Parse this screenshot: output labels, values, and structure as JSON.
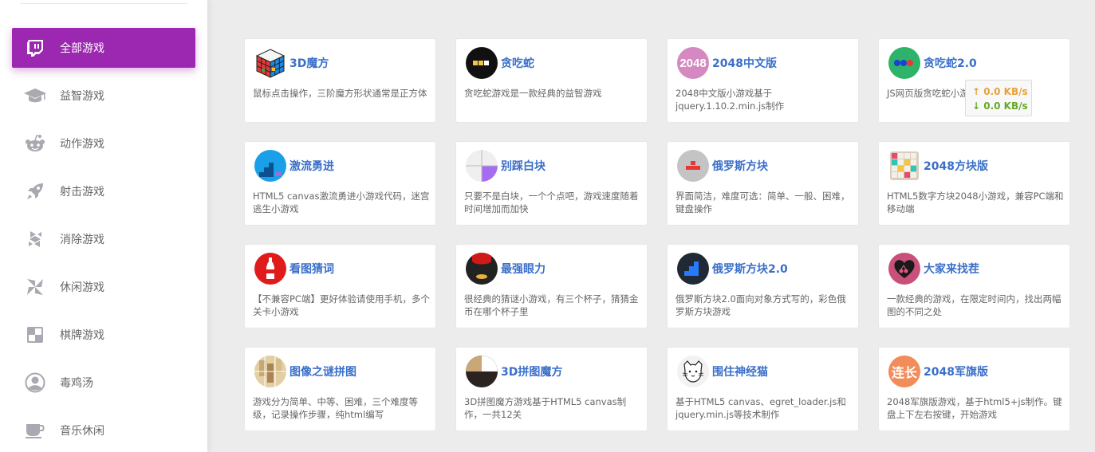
{
  "sidebar": {
    "items": [
      {
        "label": "全部游戏",
        "icon": "twitch-icon",
        "active": true
      },
      {
        "label": "益智游戏",
        "icon": "graduation-cap-icon",
        "active": false
      },
      {
        "label": "动作游戏",
        "icon": "reddit-icon",
        "active": false
      },
      {
        "label": "射击游戏",
        "icon": "rocket-icon",
        "active": false
      },
      {
        "label": "消除游戏",
        "icon": "hubspot-icon",
        "active": false
      },
      {
        "label": "休闲游戏",
        "icon": "pinwheel-icon",
        "active": false
      },
      {
        "label": "棋牌游戏",
        "icon": "chessboard-icon",
        "active": false
      },
      {
        "label": "毒鸡汤",
        "icon": "user-circle-icon",
        "active": false
      },
      {
        "label": "音乐休闲",
        "icon": "coffee-cup-icon",
        "active": false
      }
    ]
  },
  "games": [
    {
      "title": "3D魔方",
      "desc": "鼠标点击操作，三阶魔方形状通常是正方体",
      "icon": "rubiks-cube-icon"
    },
    {
      "title": "贪吃蛇",
      "desc": "贪吃蛇游戏是一款经典的益智游戏",
      "icon": "snake-icon"
    },
    {
      "title": "2048中文版",
      "desc": "2048中文版小游戏基于jquery.1.10.2.min.js制作",
      "icon": "2048-icon",
      "logo_text": "2048"
    },
    {
      "title": "贪吃蛇2.0",
      "desc": "JS网页版贪吃蛇小游戏",
      "icon": "snake-dots-icon"
    },
    {
      "title": "激流勇进",
      "desc": "HTML5 canvas激流勇进小游戏代码，迷宫逃生小游戏",
      "icon": "stairs-icon"
    },
    {
      "title": "别踩白块",
      "desc": "只要不是白块，一个个点吧，游戏速度随着时间增加而加快",
      "icon": "tiles-icon"
    },
    {
      "title": "俄罗斯方块",
      "desc": "界面简洁，难度可选：简单、一般、困难，键盘操作",
      "icon": "tetris-red-icon"
    },
    {
      "title": "2048方块版",
      "desc": "HTML5数字方块2048小游戏，兼容PC端和移动端",
      "icon": "grid-blocks-icon"
    },
    {
      "title": "看图猜词",
      "desc": "【不兼容PC端】更好体验请使用手机，多个关卡小游戏",
      "icon": "bottle-icon"
    },
    {
      "title": "最强眼力",
      "desc": "很经典的猜谜小游戏，有三个杯子，猜猜金币在哪个杯子里",
      "icon": "cup-coin-icon"
    },
    {
      "title": "俄罗斯方块2.0",
      "desc": "俄罗斯方块2.0面向对象方式写的，彩色俄罗斯方块游戏",
      "icon": "tetris-blue-icon"
    },
    {
      "title": "大家来找茬",
      "desc": "一款经典的游戏，在限定时间内，找出两幅图的不同之处",
      "icon": "heart-cherry-icon"
    },
    {
      "title": "图像之谜拼图",
      "desc": "游戏分为简单、中等、困难，三个难度等级，记录操作步骤，纯html编写",
      "icon": "puzzle-photo-icon"
    },
    {
      "title": "3D拼图魔方",
      "desc": "3D拼图魔方游戏基于HTML5 canvas制作，一共12关",
      "icon": "puzzle-cube-icon"
    },
    {
      "title": "围住神经猫",
      "desc": "基于HTML5 canvas、egret_loader.js和jquery.min.js等技术制作",
      "icon": "cat-icon"
    },
    {
      "title": "2048军旗版",
      "desc": "2048军旗版游戏，基于html5+js制作。键盘上下左右按键，开始游戏",
      "icon": "lianzhang-icon",
      "logo_text": "连长"
    }
  ],
  "netspeed": {
    "up": "↑ 0.0 KB/s",
    "down": "↓ 0.0 KB/s"
  },
  "colors": {
    "accent": "#9c27b0",
    "title": "#3a6fc9",
    "background": "#ececec"
  }
}
